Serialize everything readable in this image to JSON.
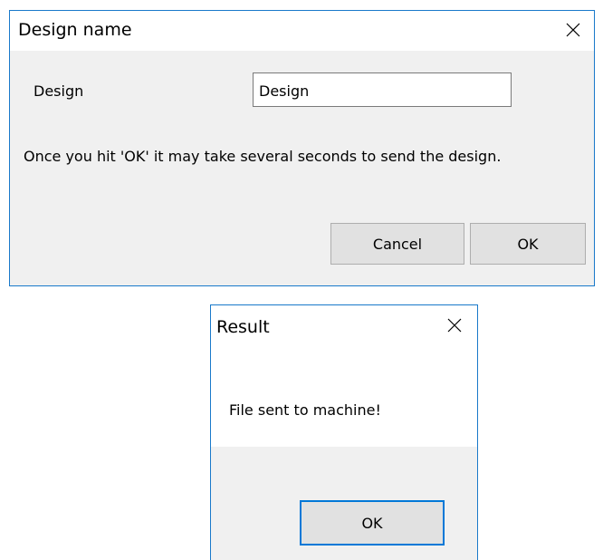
{
  "design_dialog": {
    "title": "Design name",
    "design_label": "Design",
    "design_input_value": "Design",
    "info_text": "Once you hit 'OK' it may take several seconds to send the design.",
    "cancel_label": "Cancel",
    "ok_label": "OK",
    "close_icon": "close-icon"
  },
  "result_dialog": {
    "title": "Result",
    "message": "File sent to machine!",
    "ok_label": "OK",
    "close_icon": "close-icon"
  },
  "colors": {
    "window_border": "#1979ca",
    "client_background": "#f0f0f0",
    "button_face": "#e1e1e1",
    "default_button_border": "#0078d7"
  }
}
